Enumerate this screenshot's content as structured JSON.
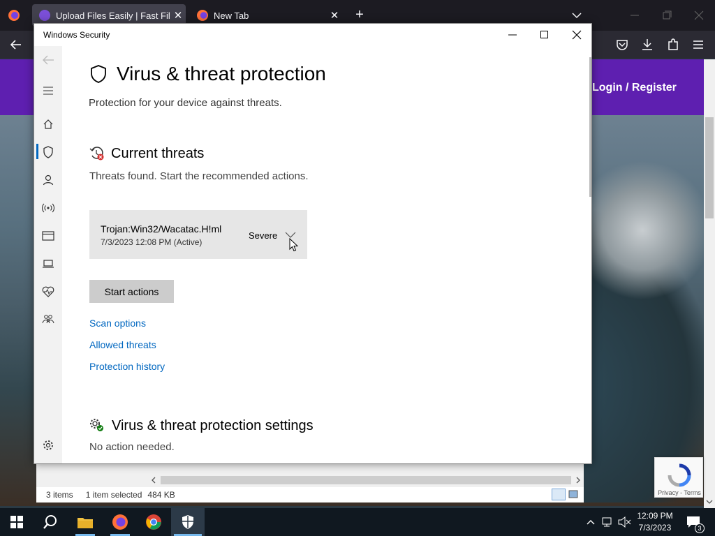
{
  "browser": {
    "tabs": [
      {
        "label": "Upload Files Easily | Fast File Up",
        "active": true
      },
      {
        "label": "New Tab",
        "active": false
      }
    ],
    "new_tab_symbol": "+",
    "tab_close_symbol": "✕"
  },
  "site": {
    "login_label": "Login / Register",
    "brand_color": "#5e1fb0"
  },
  "explorer": {
    "item_count": "3 items",
    "selection": "1 item selected",
    "size": "484 KB"
  },
  "recaptcha": {
    "privacy": "Privacy",
    "separator": " - ",
    "terms": "Terms"
  },
  "security": {
    "window_title": "Windows Security",
    "page_title": "Virus & threat protection",
    "page_subtitle": "Protection for your device against threats.",
    "current_threats_heading": "Current threats",
    "current_threats_status": "Threats found. Start the recommended actions.",
    "threat": {
      "name": "Trojan:Win32/Wacatac.H!ml",
      "datetime": "7/3/2023 12:08 PM (Active)",
      "severity": "Severe"
    },
    "start_actions_label": "Start actions",
    "links": [
      "Scan options",
      "Allowed threats",
      "Protection history"
    ],
    "settings_heading": "Virus & threat protection settings",
    "settings_status": "No action needed.",
    "accent_color": "#0067c0",
    "sidebar_icons": [
      "hamburger-icon",
      "home-icon",
      "shield-icon",
      "person-icon",
      "wireless-icon",
      "app-browser-icon",
      "laptop-icon",
      "health-icon",
      "family-icon",
      "settings-icon"
    ]
  },
  "taskbar": {
    "time": "12:09 PM",
    "date": "7/3/2023",
    "notification_count": "3"
  }
}
